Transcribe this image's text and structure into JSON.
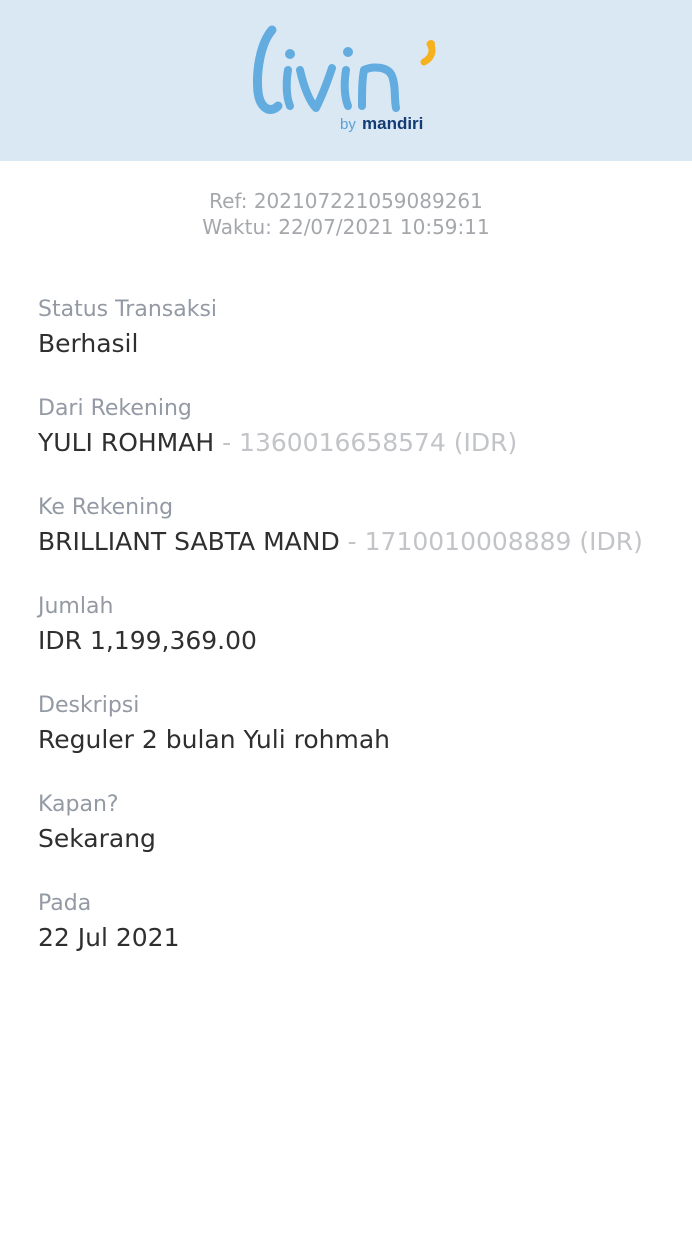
{
  "brand": {
    "logo_word": "livin'",
    "logo_by": "by",
    "logo_bank": "mandiri",
    "colors": {
      "logo_blue": "#62ace0",
      "logo_yellow": "#f6b11f",
      "mandiri_navy": "#143c74"
    }
  },
  "receipt": {
    "ref": "Ref: 202107221059089261",
    "time": "Waktu: 22/07/2021 10:59:11"
  },
  "fields": {
    "status": {
      "label": "Status Transaksi",
      "value": "Berhasil"
    },
    "from": {
      "label": "Dari Rekening",
      "name": "YULI ROHMAH",
      "account": " - 1360016658574 (IDR)"
    },
    "to": {
      "label": "Ke Rekening",
      "name": "BRILLIANT SABTA MAND",
      "account": " - 1710010008889 (IDR)"
    },
    "amount": {
      "label": "Jumlah",
      "value": "IDR 1,199,369.00"
    },
    "description": {
      "label": "Deskripsi",
      "value": "Reguler 2 bulan Yuli rohmah"
    },
    "when": {
      "label": "Kapan?",
      "value": "Sekarang"
    },
    "date": {
      "label": "Pada",
      "value": "22 Jul 2021"
    }
  }
}
